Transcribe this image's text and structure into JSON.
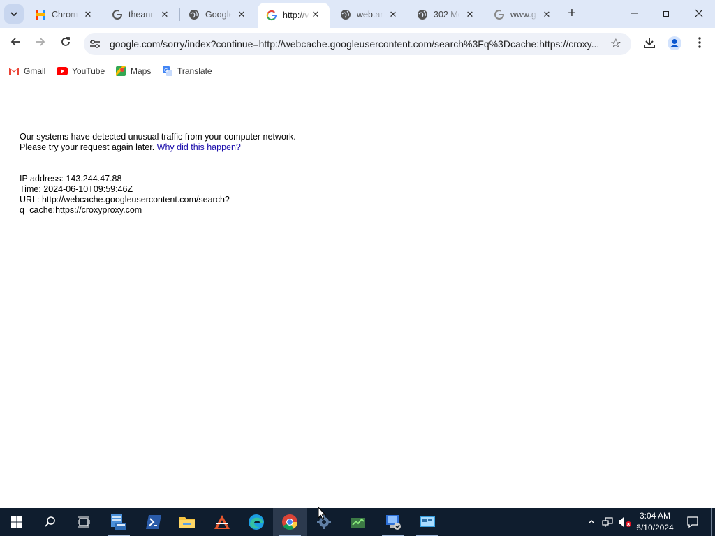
{
  "browser": {
    "tabs": [
      {
        "title": "Chrome",
        "favicon": "hotjar-icon",
        "active": false
      },
      {
        "title": "theanr",
        "favicon": "google-g-icon",
        "active": false
      },
      {
        "title": "Google",
        "favicon": "globe-icon",
        "active": false
      },
      {
        "title": "http://v",
        "favicon": "google-g-icon",
        "active": true
      },
      {
        "title": "web.ar",
        "favicon": "globe-icon",
        "active": false
      },
      {
        "title": "302 Mo",
        "favicon": "globe-icon",
        "active": false
      },
      {
        "title": "www.g",
        "favicon": "google-g-icon-gray",
        "active": false
      }
    ],
    "address_bar": {
      "url": "google.com/sorry/index?continue=http://webcache.googleusercontent.com/search%3Fq%3Dcache:https://croxy..."
    },
    "bookmarks": [
      {
        "label": "Gmail",
        "icon": "gmail-icon"
      },
      {
        "label": "YouTube",
        "icon": "youtube-icon"
      },
      {
        "label": "Maps",
        "icon": "maps-icon"
      },
      {
        "label": "Translate",
        "icon": "translate-icon"
      }
    ]
  },
  "page": {
    "message_text": "Our systems have detected unusual traffic from your computer network. Please try your request again later.",
    "link_text": "Why did this happen?",
    "ip_line": "IP address: 143.244.47.88",
    "time_line": "Time: 2024-06-10T09:59:46Z",
    "url_line_1": "URL: http://webcache.googleusercontent.com/search?",
    "url_line_2": "q=cache:https://croxyproxy.com"
  },
  "taskbar": {
    "clock_time": "3:04 AM",
    "clock_date": "6/10/2024"
  },
  "colors": {
    "tabstrip_bg": "#dfe8f8",
    "omnibox_bg": "#eef1f8",
    "link": "#1a0dab",
    "taskbar_bg": "#0f1d2e"
  }
}
